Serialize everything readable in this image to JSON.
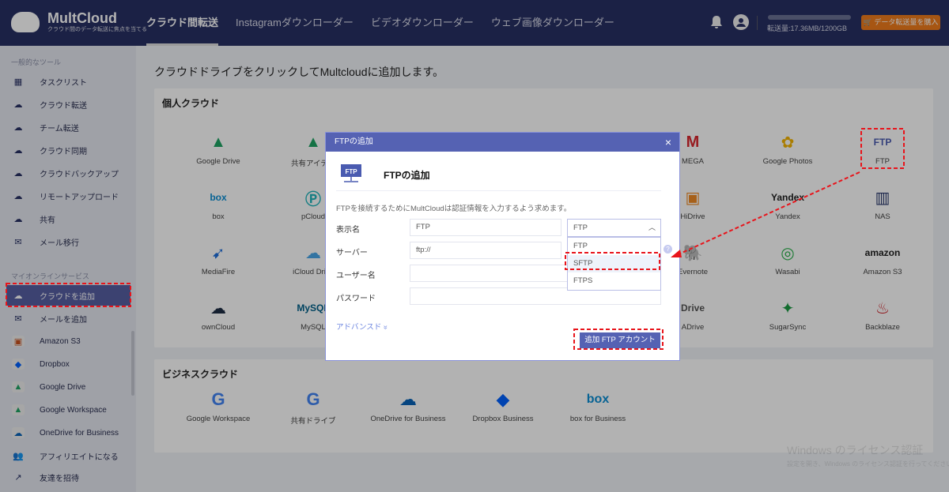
{
  "header": {
    "logo": {
      "name": "MultCloud",
      "tagline": "クラウド間のデータ転送に焦点を当てる"
    },
    "nav": [
      "クラウド間転送",
      "Instagramダウンローダー",
      "ビデオダウンローダー",
      "ウェブ画像ダウンローダー"
    ],
    "quota_text": "転送量:17.36MB/1200GB",
    "quota_used_fraction": 0.0,
    "buy_button": "データ転送量を購入"
  },
  "sidebar": {
    "section1": "一般的なツール",
    "tools": [
      "タスクリスト",
      "クラウド転送",
      "チーム転送",
      "クラウド同期",
      "クラウドバックアップ",
      "リモートアップロード",
      "共有",
      "メール移行"
    ],
    "section2": "マイオンラインサービス",
    "services": [
      "クラウドを追加",
      "メールを追加",
      "Amazon S3",
      "Dropbox",
      "Google Drive",
      "Google Workspace",
      "OneDrive for Business",
      "アフィリエイトになる",
      "友達を招待"
    ]
  },
  "main": {
    "title": "クラウドドライブをクリックしてMultcloudに追加します。",
    "personal": {
      "title": "個人クラウド",
      "rows": [
        [
          "Google Drive",
          "共有アイテム",
          "",
          "",
          "",
          "MEGA",
          "Google Photos",
          "FTP"
        ],
        [
          "box",
          "pCloud",
          "",
          "",
          "",
          "HiDrive",
          "Yandex",
          "NAS"
        ],
        [
          "MediaFire",
          "iCloud Drive",
          "",
          "",
          "",
          "Evernote",
          "Wasabi",
          "Amazon S3"
        ],
        [
          "ownCloud",
          "MySQL",
          "",
          "",
          "",
          "ADrive",
          "SugarSync",
          "Backblaze"
        ]
      ]
    },
    "business": {
      "title": "ビジネスクラウド",
      "items": [
        "Google Workspace",
        "共有ドライブ",
        "OneDrive for Business",
        "Dropbox Business",
        "box for Business"
      ]
    }
  },
  "modal": {
    "header": "FTPの追加",
    "close": "×",
    "icon_text": "FTP",
    "title": "FTPの追加",
    "description": "FTPを接続するためにMultCloudは認証情報を入力するよう求めます。",
    "labels": {
      "display_name": "表示名",
      "server": "サーバー",
      "username": "ユーザー名",
      "password": "パスワード"
    },
    "values": {
      "display_name": "FTP",
      "server": "ftp://",
      "username": "",
      "password": ""
    },
    "protocol": {
      "selected": "FTP",
      "options": [
        "FTP",
        "SFTP",
        "FTPS"
      ]
    },
    "help": "?",
    "advanced": "アドバンスド",
    "advanced_icon": "»",
    "add_button": "追加  FTP アカウント"
  },
  "watermark": {
    "line1": "Windows のライセンス認証",
    "line2": "設定を開き、Windows のライセンス認証を行ってください。"
  }
}
